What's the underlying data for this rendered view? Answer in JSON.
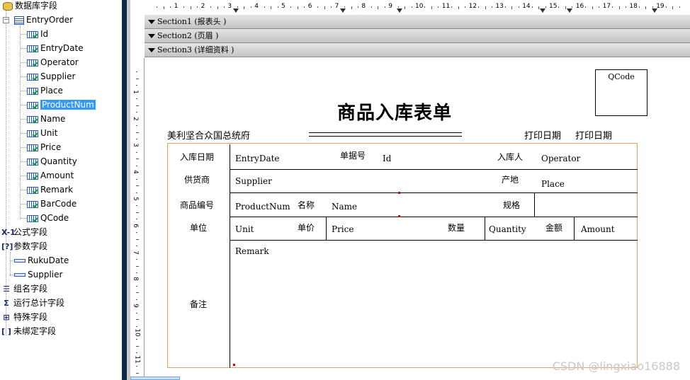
{
  "tree": {
    "root_label": "数据库字段",
    "table_label": "EntryOrder",
    "fields": [
      "Id",
      "EntryDate",
      "Operator",
      "Supplier",
      "Place",
      "ProductNum",
      "Name",
      "Unit",
      "Price",
      "Quantity",
      "Amount",
      "Remark",
      "BarCode",
      "QCode"
    ],
    "selected_field": "ProductNum",
    "formula_label": "公式字段",
    "param_label": "参数字段",
    "params": [
      "RukuDate",
      "Supplier"
    ],
    "group_label": "组名字段",
    "running_total_label": "运行总计字段",
    "special_label": "特殊字段",
    "unbound_label": "未绑定字段"
  },
  "sections": [
    {
      "label": "Section1 (报表头  )"
    },
    {
      "label": "Section2 (页眉  )"
    },
    {
      "label": "Section3 (详细资料  )"
    }
  ],
  "ruler": {
    "h_numbers": [
      "1",
      "2",
      "3",
      "4",
      "5",
      "6",
      "7",
      "8",
      "9",
      "10",
      "11",
      "12",
      "13",
      "14",
      "15",
      "16",
      "17",
      "18",
      "19"
    ],
    "v_numbers": [
      "1",
      "2",
      "3",
      "4",
      "5",
      "6",
      "7",
      "8",
      "9",
      "10",
      "11"
    ]
  },
  "report": {
    "qcode": "QCode",
    "title": "商品入库表单",
    "company": "美利坚合众国总统府",
    "print_date_label": "打印日期",
    "print_date_value": "打印日期",
    "row1": {
      "l1": "入库日期",
      "v1": "EntryDate",
      "l2": "单据号",
      "v2": "Id",
      "l3": "入库人",
      "v3": "Operator"
    },
    "row2": {
      "l1": "供货商",
      "v1": "Supplier",
      "l2": "产地",
      "v2": "Place"
    },
    "row3": {
      "l1": "商品编号",
      "v1": "ProductNum",
      "l2": "名称",
      "v2": "Name",
      "l3": "规格"
    },
    "row4": {
      "l1": "单位",
      "v1": "Unit",
      "l2": "单价",
      "v2": "Price",
      "l3": "数量",
      "v3": "Quantity",
      "l4": "金额",
      "v4": "Amount"
    },
    "row5": {
      "l1": "备注",
      "v1": "Remark"
    }
  },
  "watermark": "CSDN @lingxiao16888",
  "colors": {
    "selection": "#3399ff",
    "splitter": "#0b2a4a",
    "section_bar": "#d0d0d0",
    "outline": "#e8a060"
  }
}
